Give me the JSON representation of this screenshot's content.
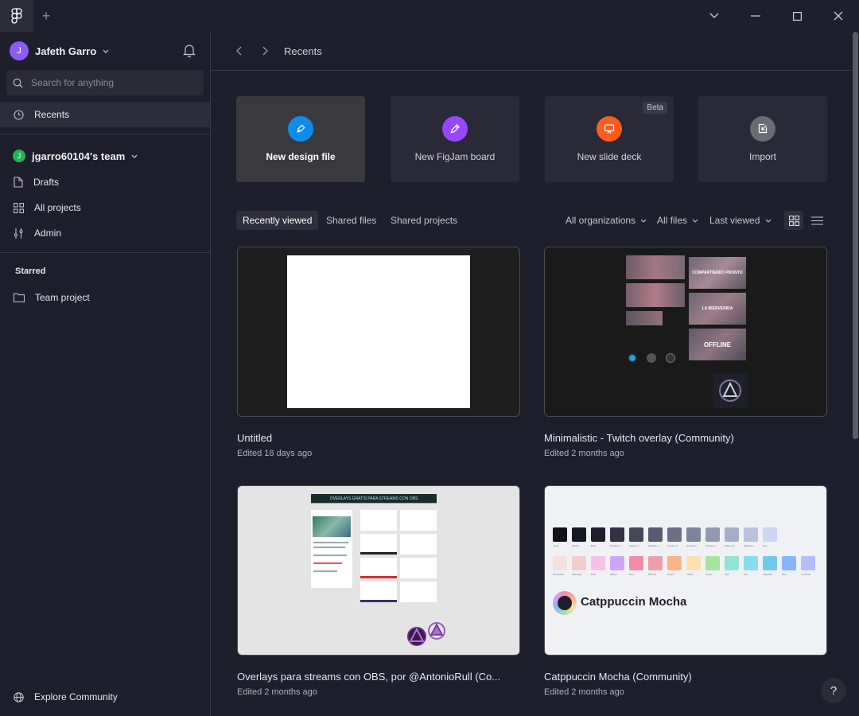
{
  "titlebar": {
    "new_tab_label": "+"
  },
  "sidebar": {
    "user": {
      "initial": "J",
      "name": "Jafeth Garro",
      "avatar_color": "#8b5cf6"
    },
    "search": {
      "placeholder": "Search for anything"
    },
    "recents_label": "Recents",
    "team": {
      "initial": "J",
      "name": "jgarro60104's team",
      "color": "#22b45a"
    },
    "team_items": [
      {
        "label": "Drafts",
        "icon": "file-icon"
      },
      {
        "label": "All projects",
        "icon": "grid-icon"
      },
      {
        "label": "Admin",
        "icon": "sliders-icon"
      }
    ],
    "starred_title": "Starred",
    "starred_items": [
      {
        "label": "Team project",
        "icon": "folder-icon"
      }
    ],
    "explore_label": "Explore Community"
  },
  "main": {
    "breadcrumb": "Recents",
    "create_cards": [
      {
        "label": "New design file",
        "color": "#0d8ce9",
        "icon": "pen-icon",
        "active": true
      },
      {
        "label": "New FigJam board",
        "color": "#9747ff",
        "icon": "marker-icon"
      },
      {
        "label": "New slide deck",
        "color": "#ff5b1f",
        "icon": "slide-icon",
        "badge": "Beta"
      },
      {
        "label": "Import",
        "color": "#6b6b73",
        "icon": "import-icon"
      }
    ],
    "tabs": [
      "Recently viewed",
      "Shared files",
      "Shared projects"
    ],
    "filters": [
      "All organizations",
      "All files",
      "Last viewed"
    ],
    "files": [
      {
        "title": "Untitled",
        "meta": "Edited 18 days ago"
      },
      {
        "title": "Minimalistic - Twitch overlay (Community)",
        "meta": "Edited 2 months ago",
        "thumb_text": [
          "COMPARTIENDO PRONTO",
          "LA BIENVENIDA",
          "OFFLINE"
        ]
      },
      {
        "title": "Overlays para streams con OBS, por @AntonioRull (Co...",
        "meta": "Edited 2 months ago",
        "thumb_text": [
          "OVERLAYS GRATIS PARA STREAMS CON OBS"
        ]
      },
      {
        "title": "Catppuccin Mocha (Community)",
        "meta": "Edited 2 months ago",
        "thumb_text": [
          "Catppuccin Mocha"
        ]
      }
    ],
    "help_label": "?"
  },
  "palette": {
    "dark": [
      "#11111b",
      "#181825",
      "#1e1e2e",
      "#313244",
      "#45475a",
      "#585b70",
      "#6c7086",
      "#7f849c",
      "#9399b2",
      "#a6adc8",
      "#bac2de",
      "#cdd6f4"
    ],
    "dark_names": [
      "Crust",
      "Mantle",
      "Base",
      "Surface 0",
      "Surface 1",
      "Surface 2",
      "Overlay 0",
      "Overlay 1",
      "Overlay 2",
      "Subtext 0",
      "Subtext 1",
      "Text"
    ],
    "accent": [
      "#f5e0dc",
      "#f2cdcd",
      "#f5c2e7",
      "#cba6f7",
      "#f38ba8",
      "#eba0ac",
      "#fab387",
      "#f9e2af",
      "#a6e3a1",
      "#94e2d5",
      "#89dceb",
      "#74c7ec",
      "#89b4fa",
      "#b4befe"
    ],
    "accent_names": [
      "Rosewater",
      "Flamingo",
      "Pink",
      "Mauve",
      "Red",
      "Maroon",
      "Peach",
      "Yellow",
      "Green",
      "Teal",
      "Sky",
      "Sapphire",
      "Blue",
      "Lavender"
    ]
  }
}
